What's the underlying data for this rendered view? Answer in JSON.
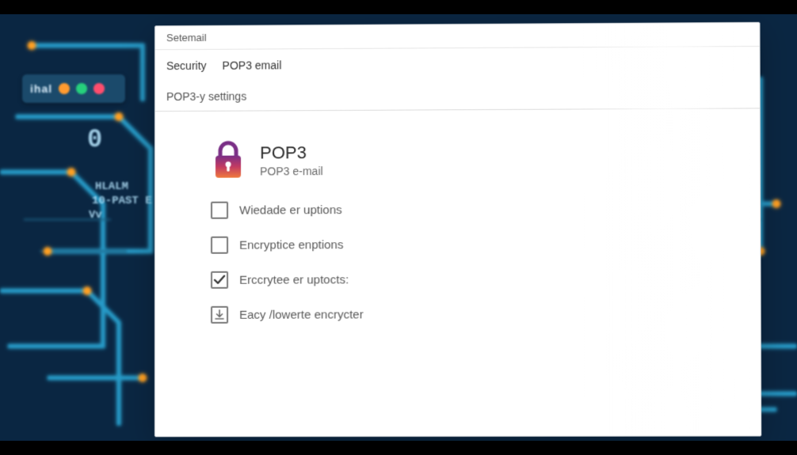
{
  "desktop": {
    "badge_label": "ihal",
    "dot_colors": [
      "#ff9b2f",
      "#26d07c",
      "#ff4d6d"
    ],
    "mono_lines": [
      "0",
      "HLALM",
      "10-PAST E",
      "Vv"
    ]
  },
  "window": {
    "title": "Setemail",
    "tabs": [
      "Security",
      "POP3 email"
    ],
    "subheader": "POP3-y settings",
    "hero": {
      "title": "POP3",
      "subtitle": "POP3 e-mail",
      "lock_colors": {
        "top": "#7a2f86",
        "mid": "#c23a62",
        "bot": "#f07a3c"
      }
    },
    "options": [
      {
        "label": "Wiedade er uptions",
        "kind": "checkbox",
        "checked": false
      },
      {
        "label": "Encryptice enptions",
        "kind": "checkbox",
        "checked": false
      },
      {
        "label": "Erccrytee er uptocts:",
        "kind": "checkbox",
        "checked": true
      },
      {
        "label": "Eacy /lowerte encrycter",
        "kind": "download",
        "checked": false
      }
    ]
  },
  "colors": {
    "circuit_line": "#2aa7d6",
    "circuit_glow": "#6fd8ff",
    "circuit_node": "#ffa023",
    "bg_dark": "#0a2642"
  }
}
